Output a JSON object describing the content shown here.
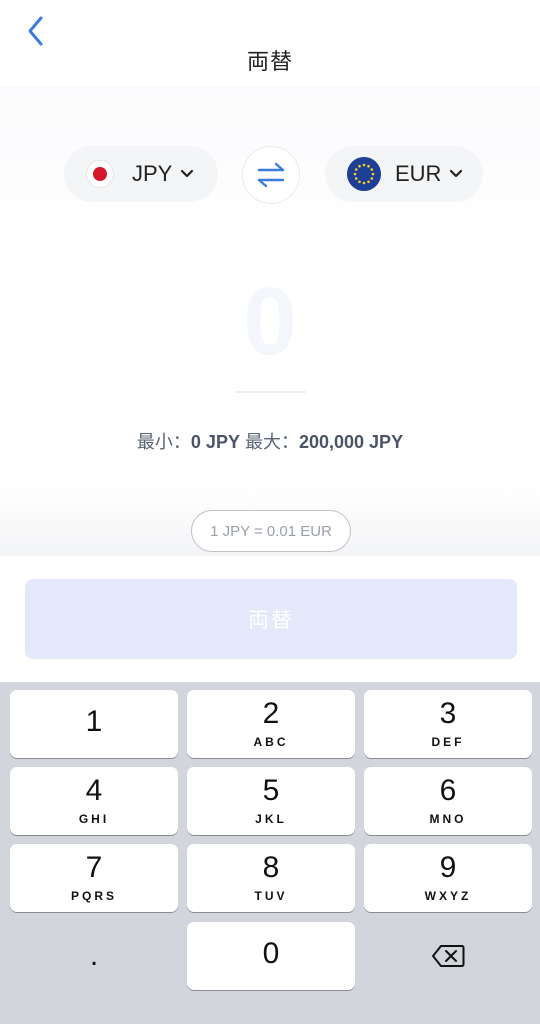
{
  "header": {
    "title": "両替"
  },
  "from": {
    "code": "JPY"
  },
  "to": {
    "code": "EUR"
  },
  "amount": {
    "value": "0"
  },
  "limits": {
    "min_label": "最小：",
    "min_value": "0 JPY",
    "max_label": "最大：",
    "max_value": "200,000 JPY"
  },
  "rate": {
    "text": "1 JPY = 0.01 EUR"
  },
  "action": {
    "exchange_label": "両替"
  },
  "keypad": {
    "k1": {
      "digit": "1",
      "letters": ""
    },
    "k2": {
      "digit": "2",
      "letters": "ABC"
    },
    "k3": {
      "digit": "3",
      "letters": "DEF"
    },
    "k4": {
      "digit": "4",
      "letters": "GHI"
    },
    "k5": {
      "digit": "5",
      "letters": "JKL"
    },
    "k6": {
      "digit": "6",
      "letters": "MNO"
    },
    "k7": {
      "digit": "7",
      "letters": "PQRS"
    },
    "k8": {
      "digit": "8",
      "letters": "TUV"
    },
    "k9": {
      "digit": "9",
      "letters": "WXYZ"
    },
    "k0": {
      "digit": "0"
    },
    "dot": {
      "digit": "."
    }
  },
  "icons": {
    "back": "chevron-left-icon",
    "swap": "swap-arrows-icon",
    "backspace": "backspace-icon"
  },
  "colors": {
    "accent": "#3b7ddd",
    "button_disabled": "#e3e8fb",
    "keyboard_bg": "#d2d5db"
  }
}
